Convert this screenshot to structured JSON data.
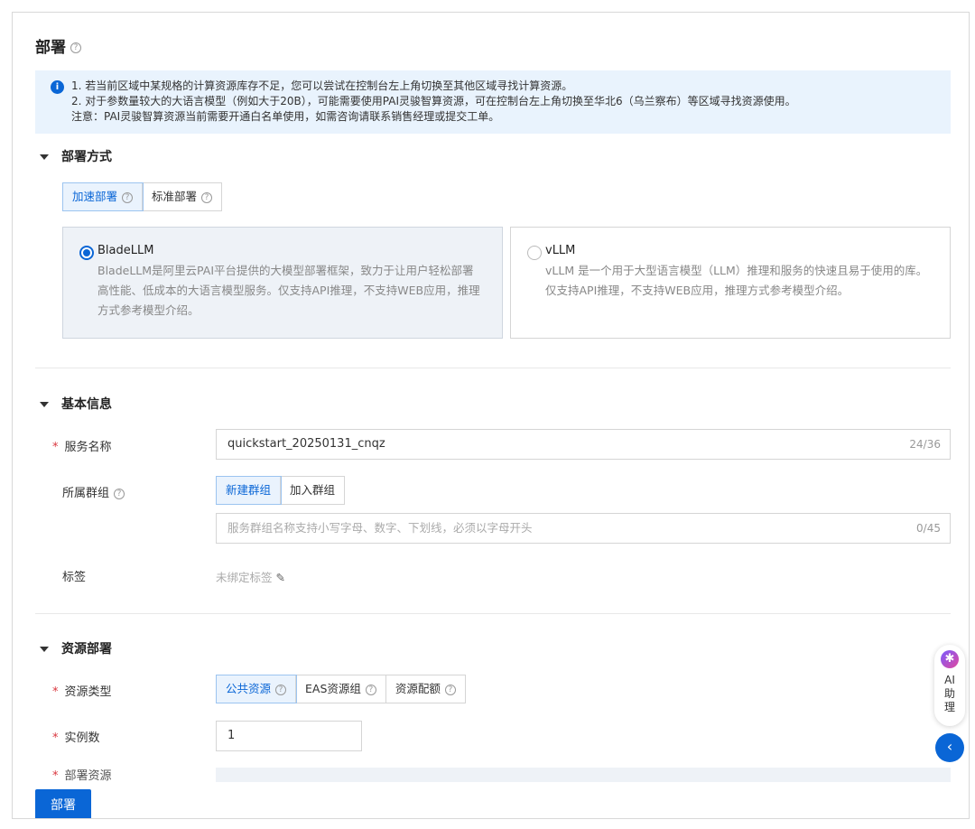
{
  "page": {
    "title": "部署"
  },
  "alert": {
    "lines": [
      "1. 若当前区域中某规格的计算资源库存不足，您可以尝试在控制台左上角切换至其他区域寻找计算资源。",
      "2. 对于参数量较大的大语言模型（例如大于20B），可能需要使用PAI灵骏智算资源，可在控制台左上角切换至华北6（乌兰察布）等区域寻找资源使用。",
      "注意：PAI灵骏智算资源当前需要开通白名单使用，如需咨询请联系销售经理或提交工单。"
    ]
  },
  "deploy_method": {
    "title": "部署方式",
    "tabs": [
      "加速部署",
      "标准部署"
    ],
    "options": [
      {
        "name": "BladeLLM",
        "desc": "BladeLLM是阿里云PAI平台提供的大模型部署框架，致力于让用户轻松部署高性能、低成本的大语言模型服务。仅支持API推理，不支持WEB应用，推理方式参考模型介绍。",
        "selected": true
      },
      {
        "name": "vLLM",
        "desc": "vLLM 是一个用于大型语言模型（LLM）推理和服务的快速且易于使用的库。仅支持API推理，不支持WEB应用，推理方式参考模型介绍。",
        "selected": false
      }
    ]
  },
  "basic": {
    "title": "基本信息",
    "service_name_label": "服务名称",
    "service_name": "quickstart_20250131_cnqz",
    "service_name_count": "24/36",
    "group_label": "所属群组",
    "group_tabs": [
      "新建群组",
      "加入群组"
    ],
    "group_placeholder": "服务群组名称支持小写字母、数字、下划线，必须以字母开头",
    "group_count": "0/45",
    "tag_label": "标签",
    "tag_value": "未绑定标签"
  },
  "resource": {
    "title": "资源部署",
    "type_label": "资源类型",
    "type_tabs": [
      "公共资源",
      "EAS资源组",
      "资源配额"
    ],
    "instances_label": "实例数",
    "instances": "1",
    "deploy_resource_label": "部署资源"
  },
  "footer": {
    "deploy_button": "部署"
  },
  "assistant": {
    "label_1": "AI",
    "label_2": "助",
    "label_3": "理"
  }
}
